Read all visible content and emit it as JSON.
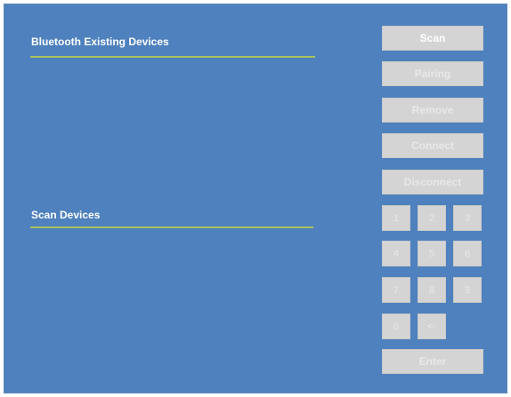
{
  "existing": {
    "title": "Bluetooth Existing Devices"
  },
  "scan_section": {
    "title": "Scan Devices"
  },
  "buttons": {
    "scan": "Scan",
    "pairing": "Pairing",
    "remove": "Remove",
    "connect": "Connect",
    "disconnect": "Disconnect",
    "enter": "Enter"
  },
  "keypad": {
    "k1": "1",
    "k2": "2",
    "k3": "3",
    "k4": "4",
    "k5": "5",
    "k6": "6",
    "k7": "7",
    "k8": "8",
    "k9": "9",
    "k0": "0",
    "back": "<-"
  },
  "colors": {
    "panel": "#4e81bd",
    "rule": "#a9c35a",
    "button": "#d4d4d4",
    "button_text": "#e8e8e8"
  }
}
